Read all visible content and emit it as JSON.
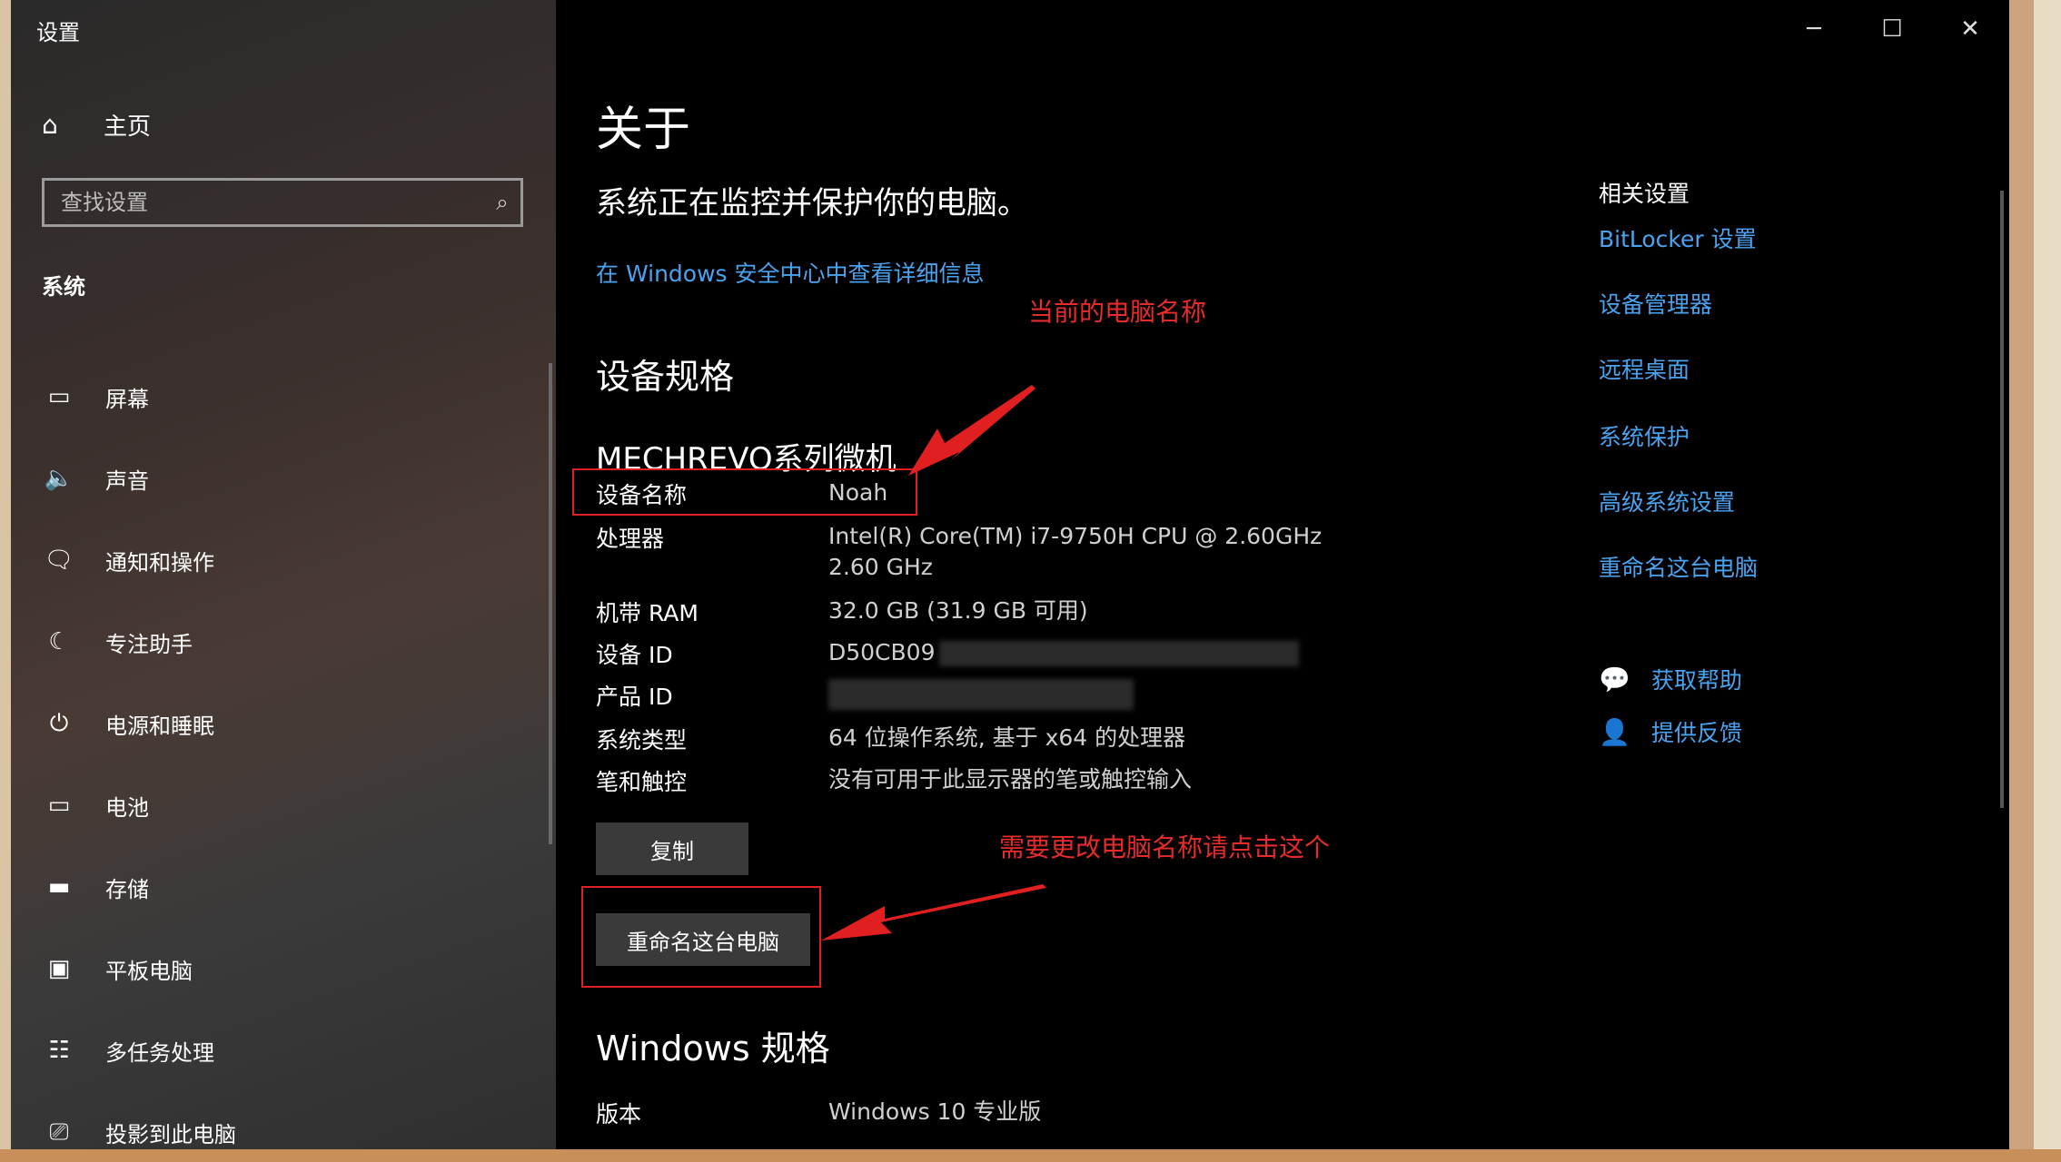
{
  "window": {
    "title": "设置",
    "controls": {
      "minimize": "─",
      "maximize": "☐",
      "close": "✕"
    }
  },
  "sidebar": {
    "home_label": "主页",
    "home_icon": "⌂",
    "search_placeholder": "查找设置",
    "search_icon": "⌕",
    "section_label": "系统",
    "items": [
      {
        "label": "屏幕",
        "icon": "▭"
      },
      {
        "label": "声音",
        "icon": "🔈"
      },
      {
        "label": "通知和操作",
        "icon": "🗨"
      },
      {
        "label": "专注助手",
        "icon": "☾"
      },
      {
        "label": "电源和睡眠",
        "icon": "⏻"
      },
      {
        "label": "电池",
        "icon": "▭"
      },
      {
        "label": "存储",
        "icon": "▬"
      },
      {
        "label": "平板电脑",
        "icon": "▣"
      },
      {
        "label": "多任务处理",
        "icon": "☷"
      },
      {
        "label": "投影到此电脑",
        "icon": "⎚"
      }
    ]
  },
  "main": {
    "title": "关于",
    "protect_text": "系统正在监控并保护你的电脑。",
    "security_link": "在 Windows 安全中心中查看详细信息",
    "device_spec_heading": "设备规格",
    "device_model": "MECHREVO系列微机",
    "specs": [
      {
        "label": "设备名称",
        "value": "Noah"
      },
      {
        "label": "处理器",
        "value": "Intel(R) Core(TM) i7-9750H CPU @ 2.60GHz   2.60 GHz"
      },
      {
        "label": "机带 RAM",
        "value": "32.0 GB (31.9 GB 可用)"
      },
      {
        "label": "设备 ID",
        "value": "D50CB09"
      },
      {
        "label": "产品 ID",
        "value": ""
      },
      {
        "label": "系统类型",
        "value": "64 位操作系统, 基于 x64 的处理器"
      },
      {
        "label": "笔和触控",
        "value": "没有可用于此显示器的笔或触控输入"
      }
    ],
    "copy_button": "复制",
    "rename_button": "重命名这台电脑",
    "windows_spec_heading": "Windows 规格",
    "windows_specs": [
      {
        "label": "版本",
        "value": "Windows 10 专业版"
      }
    ]
  },
  "related": {
    "title": "相关设置",
    "links": [
      "BitLocker 设置",
      "设备管理器",
      "远程桌面",
      "系统保护",
      "高级系统设置",
      "重命名这台电脑"
    ],
    "help": [
      {
        "label": "获取帮助",
        "icon": "💬"
      },
      {
        "label": "提供反馈",
        "icon": "👤"
      }
    ]
  },
  "annotations": {
    "pc_name_note": "当前的电脑名称",
    "rename_note": "需要更改电脑名称请点击这个",
    "color": "#e02020"
  }
}
